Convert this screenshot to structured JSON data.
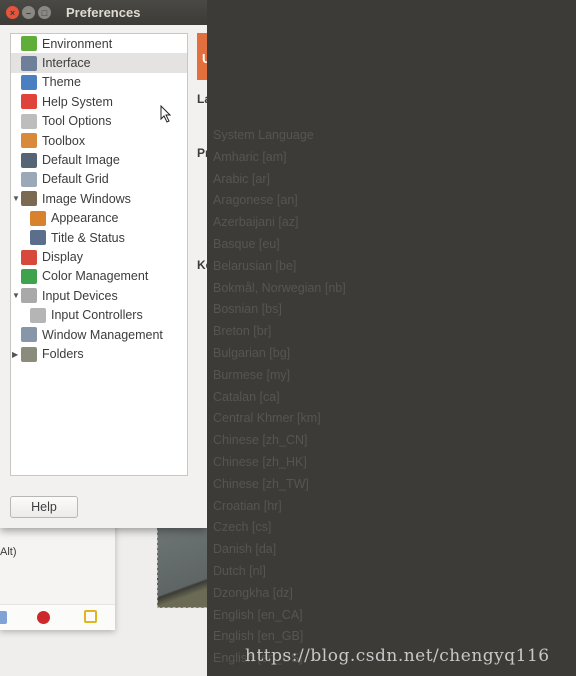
{
  "window": {
    "title": "Preferences",
    "help_label": "Help"
  },
  "tree": [
    {
      "label": "Environment",
      "icon": "environment-icon",
      "color": "#5fae3a",
      "indent": 0
    },
    {
      "label": "Interface",
      "icon": "interface-icon",
      "color": "#6d7f99",
      "indent": 0,
      "selected": true
    },
    {
      "label": "Theme",
      "icon": "theme-icon",
      "color": "#4a7fc1",
      "indent": 0
    },
    {
      "label": "Help System",
      "icon": "lifebuoy-icon",
      "color": "#e0433a",
      "indent": 0
    },
    {
      "label": "Tool Options",
      "icon": "tool-options-icon",
      "color": "#bdbdbd",
      "indent": 0
    },
    {
      "label": "Toolbox",
      "icon": "toolbox-icon",
      "color": "#d9893a",
      "indent": 0
    },
    {
      "label": "Default Image",
      "icon": "default-image-icon",
      "color": "#566576",
      "indent": 0
    },
    {
      "label": "Default Grid",
      "icon": "grid-icon",
      "color": "#9aa8b8",
      "indent": 0
    },
    {
      "label": "Image Windows",
      "icon": "image-windows-icon",
      "color": "#7a6a52",
      "indent": 0,
      "expander": "expanded"
    },
    {
      "label": "Appearance",
      "icon": "appearance-icon",
      "color": "#d8822e",
      "indent": 1
    },
    {
      "label": "Title & Status",
      "icon": "title-status-icon",
      "color": "#5b6f8c",
      "indent": 1
    },
    {
      "label": "Display",
      "icon": "display-icon",
      "color": "#d6493b",
      "indent": 0
    },
    {
      "label": "Color Management",
      "icon": "color-management-icon",
      "color": "#3fa34d",
      "indent": 0
    },
    {
      "label": "Input Devices",
      "icon": "input-devices-icon",
      "color": "#a9a9a9",
      "indent": 0,
      "expander": "expanded"
    },
    {
      "label": "Input Controllers",
      "icon": "input-controllers-icon",
      "color": "#b5b5b5",
      "indent": 1
    },
    {
      "label": "Window Management",
      "icon": "window-management-icon",
      "color": "#8796a8",
      "indent": 0
    },
    {
      "label": "Folders",
      "icon": "folder-icon",
      "color": "#8c8c7c",
      "indent": 0,
      "expander": "collapsed"
    }
  ],
  "side_strip": {
    "header": "U",
    "labels": [
      "La",
      "Pr",
      "Ke"
    ]
  },
  "background_dialog": {
    "text": "Alt)"
  },
  "language_list": [
    "System Language",
    "Amharic [am]",
    "Arabic [ar]",
    "Aragonese [an]",
    "Azerbaijani [az]",
    "Basque [eu]",
    "Belarusian [be]",
    "Bokmål, Norwegian [nb]",
    "Bosnian [bs]",
    "Breton [br]",
    "Bulgarian [bg]",
    "Burmese [my]",
    "Catalan [ca]",
    "Central Khmer [km]",
    "Chinese [zh_CN]",
    "Chinese [zh_HK]",
    "Chinese [zh_TW]",
    "Croatian [hr]",
    "Czech [cs]",
    "Danish [da]",
    "Dutch [nl]",
    "Dzongkha [dz]",
    "English [en_CA]",
    "English [en_GB]",
    "English [en_US]"
  ],
  "watermark": "https://blog.csdn.net/chengyq116",
  "colors": {
    "titlebar": "#3c3b37",
    "accent": "#e2703f",
    "dropdown_bg": "#3c3b37",
    "close": "#e6553a"
  }
}
